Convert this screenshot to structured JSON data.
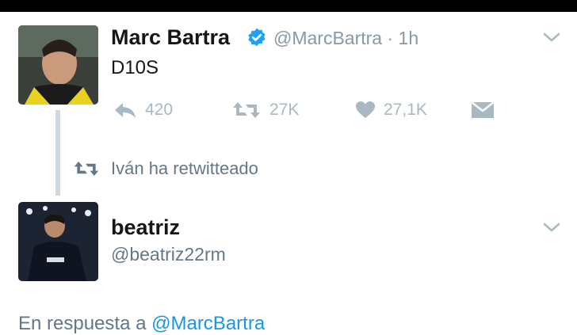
{
  "tweet1": {
    "name": "Marc Bartra",
    "handle_time": "@MarcBartra · 1h",
    "text": "D10S",
    "actions": {
      "reply_count": "420",
      "retweet_count": "27K",
      "like_count": "27,1K"
    }
  },
  "retweet_label": "Iván ha retwitteado",
  "tweet2": {
    "name": "beatriz",
    "handle": "@beatriz22rm",
    "reply_prefix": "En respuesta a",
    "reply_mention": "@MarcBartra"
  },
  "colors": {
    "verified": "#1da1f2",
    "icon_gray": "#aab8c2",
    "link": "#1b95e0"
  }
}
